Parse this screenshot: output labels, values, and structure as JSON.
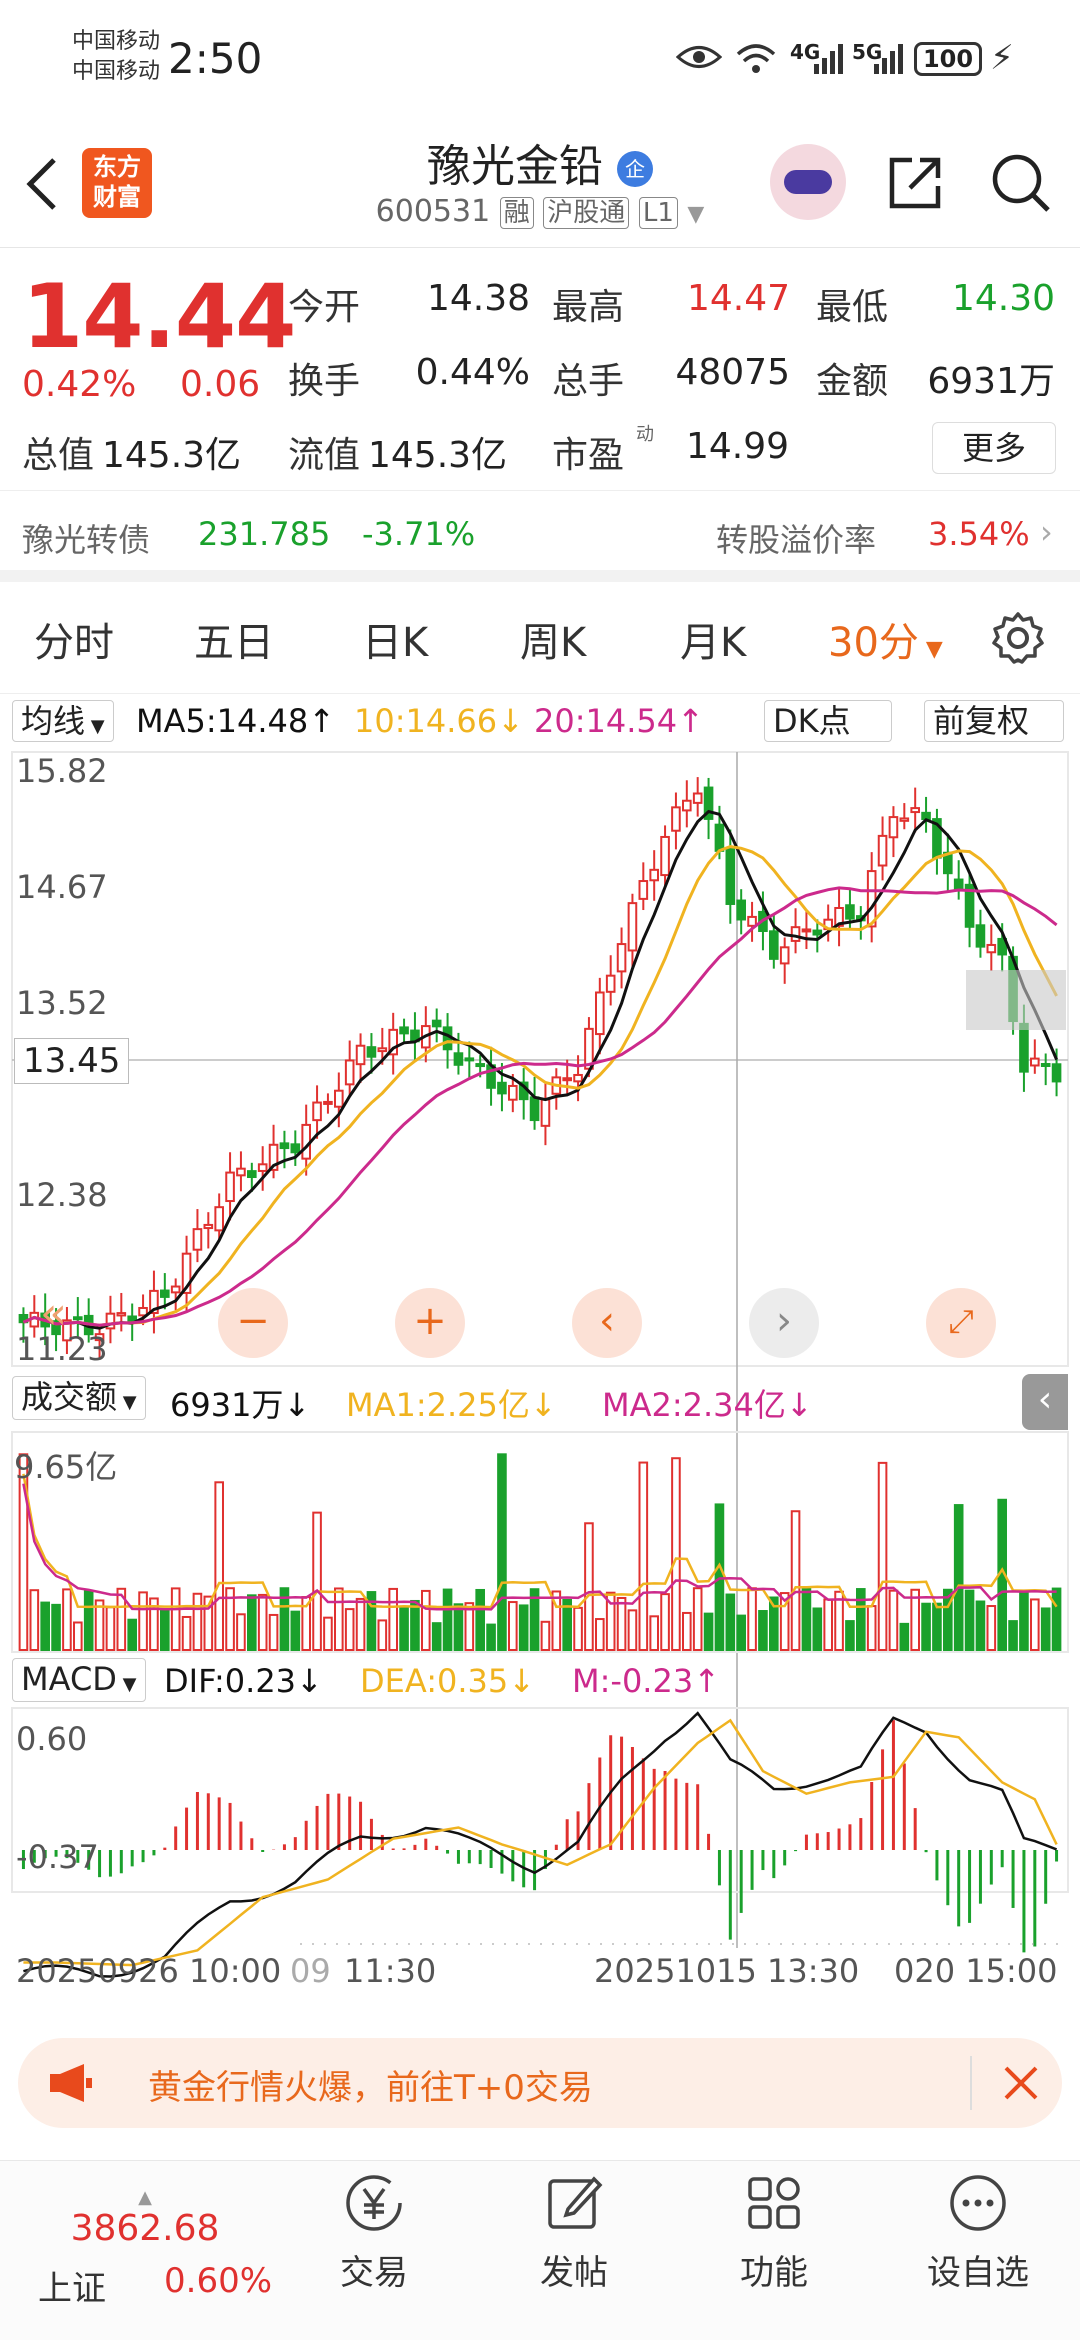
{
  "status_bar": {
    "carrier1": "中国移动",
    "carrier2": "中国移动",
    "time": "2:50",
    "network1": "4G",
    "network2": "5G",
    "battery": "100"
  },
  "header": {
    "logo_text1": "东方",
    "logo_text2": "财富",
    "title": "豫光金铅",
    "title_badge": "企",
    "code": "600531",
    "tags": [
      "融",
      "沪股通",
      "L1"
    ]
  },
  "quote": {
    "price": "14.44",
    "change_pct": "0.42%",
    "change": "0.06",
    "open_label": "今开",
    "open": "14.38",
    "high_label": "最高",
    "high": "14.47",
    "low_label": "最低",
    "low": "14.30",
    "turnover_label": "换手",
    "turnover": "0.44%",
    "volume_label": "总手",
    "volume": "48075",
    "amount_label": "金额",
    "amount": "6931万",
    "mktcap_label": "总值",
    "mktcap": "145.3亿",
    "float_label": "流值",
    "float": "145.3亿",
    "pe_label": "市盈",
    "pe_sup": "动",
    "pe": "14.99",
    "more_button": "更多"
  },
  "bond": {
    "name": "豫光转债",
    "price": "231.785",
    "change": "-3.71%",
    "premium_label": "转股溢价率",
    "premium": "3.54%"
  },
  "tabs": {
    "items": [
      "分时",
      "五日",
      "日K",
      "周K",
      "月K"
    ],
    "active": "30分"
  },
  "ma_row": {
    "selector": "均线",
    "ma5": "MA5:14.48↑",
    "ma10": "10:14.66↓",
    "ma20": "20:14.54↑",
    "dk": "DK点",
    "adjust": "前复权"
  },
  "chart": {
    "y_labels": [
      "15.82",
      "14.67",
      "13.52",
      "12.38",
      "11.23"
    ],
    "cursor_price": "13.45",
    "vol_selector": "成交额",
    "vol_value": "6931万↓",
    "vol_ma1": "MA1:2.25亿↓",
    "vol_ma2": "MA2:2.34亿↓",
    "vol_max": "9.65亿",
    "macd_selector": "MACD",
    "dif": "DIF:0.23↓",
    "dea": "DEA:0.35↓",
    "m": "M:-0.23↑",
    "macd_max": "0.60",
    "macd_min": "-0.37",
    "x_labels": [
      "20250926 10:00",
      "09",
      "11:30",
      "20251015 13:30",
      "020 15:00"
    ]
  },
  "promo": {
    "text": "黄金行情火爆，前往T+0交易"
  },
  "bottom": {
    "index_value": "3862.68",
    "index_name": "上证",
    "index_change": "0.60%",
    "nav": [
      "交易",
      "发帖",
      "功能",
      "设自选"
    ]
  },
  "colors": {
    "up": "#e0312f",
    "down": "#1aa12c",
    "accent": "#e8681c",
    "ma5": "#111111",
    "ma10": "#f0b320",
    "ma20": "#cc2a8c"
  }
}
